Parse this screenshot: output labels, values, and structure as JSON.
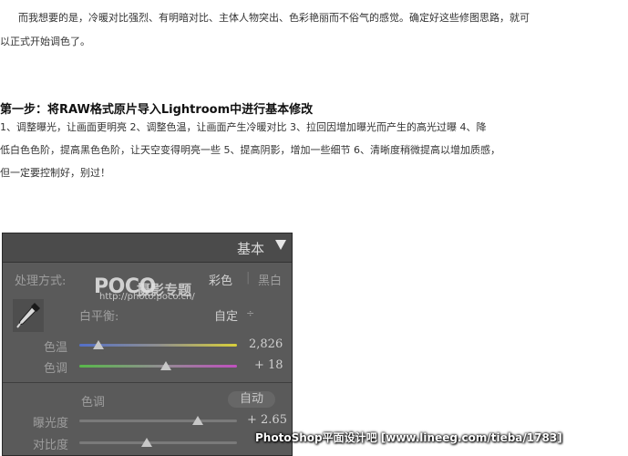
{
  "article": {
    "intro_line1": "而我想要的是，冷暖对比强烈、有明暗对比、主体人物突出、色彩艳丽而不俗气的感觉。确定好这些修图思路，就可",
    "intro_line2": "以正式开始调色了。",
    "heading": "第一步：将RAW格式原片导入Lightroom中进行基本修改",
    "steps_line1": "1、调整曝光，让画面更明亮      2、调整色温，让画面产生冷暖对比      3、拉回因增加曝光而产生的高光过曝      4、降",
    "steps_line2": "低白色色阶，提高黑色色阶，让天空变得明亮一些      5、提高阴影，增加一些细节      6、清晰度稍微提高以增加质感，",
    "steps_line3": "但一定要控制好，别过！"
  },
  "panel": {
    "title": "基本",
    "treatment_label": "处理方式:",
    "treatment_color": "彩色",
    "treatment_divider": "|",
    "treatment_bw": "黑白",
    "wb_label": "白平衡:",
    "wb_value": "自定",
    "wb_arrows": "÷",
    "temp_label": "色温",
    "temp_value": "2,826",
    "temp_position": 0.12,
    "tint_label": "色调",
    "tint_value": "+ 18",
    "tint_position": 0.55,
    "tone_label": "色调",
    "auto_label": "自动",
    "exposure_label": "曝光度",
    "exposure_value": "+ 2.65",
    "exposure_position": 0.75,
    "contrast_label": "对比度",
    "contrast_position": 0.43
  },
  "watermarks": {
    "poco_brand": "POCO",
    "poco_sub": "摄影专题",
    "poco_url": "http://photo.poco.cn/",
    "site": "PhotoShop平面设计吧 [www.lineeg.com/tieba/1783]"
  },
  "colors": {
    "panel_bg": "#5a5a5a",
    "temp_track": "#c8c23c",
    "tint_track": "#b84fb0"
  }
}
